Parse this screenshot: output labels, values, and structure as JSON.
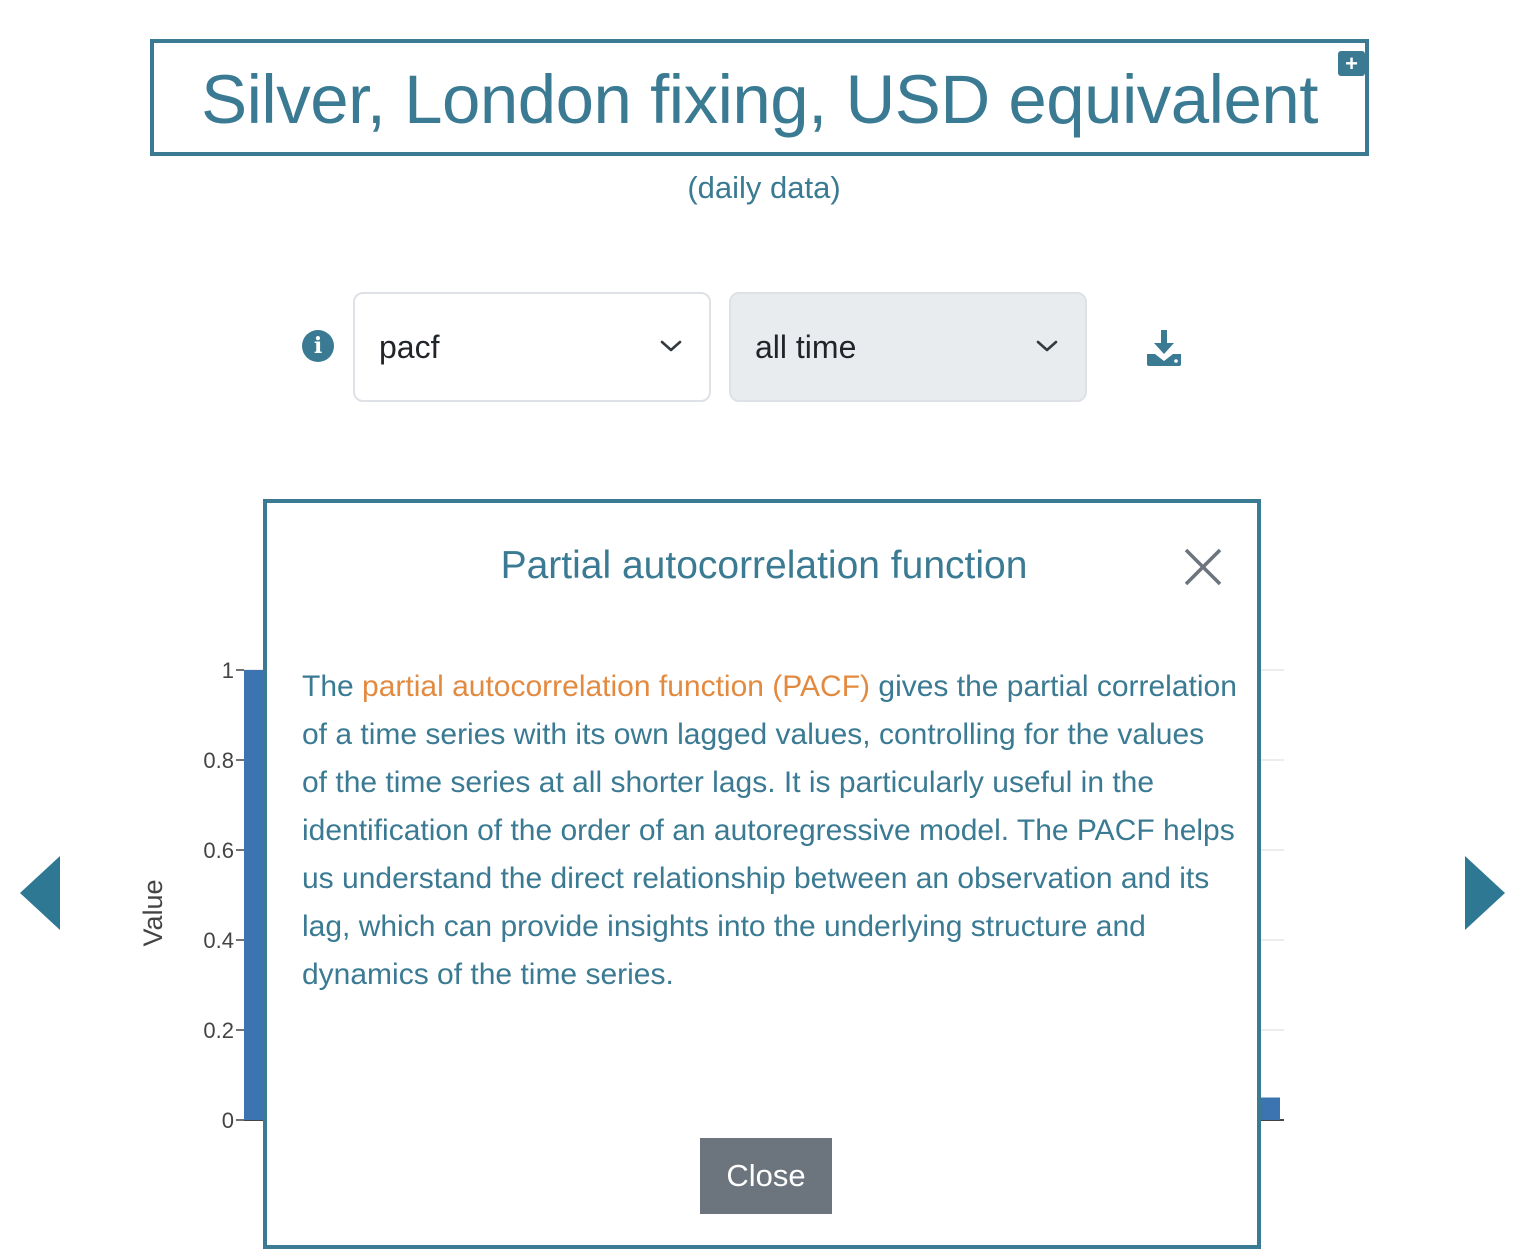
{
  "header": {
    "title": "Silver, London fixing, USD equivalent",
    "subtitle": "(daily data)",
    "expand_label": "+"
  },
  "controls": {
    "function_select": {
      "value": "pacf"
    },
    "range_select": {
      "value": "all time"
    }
  },
  "icons": {
    "info": "info-icon",
    "download": "download-icon",
    "expand": "plus-icon",
    "prev": "arrow-left-icon",
    "next": "arrow-right-icon",
    "close": "close-icon"
  },
  "colors": {
    "accent": "#3a7a93",
    "highlight": "#e38a41",
    "bar": "#3b74b1",
    "button_gray": "#6c757d"
  },
  "chart_data": {
    "type": "bar",
    "ylabel": "Value",
    "ylim": [
      0,
      1
    ],
    "yticks": [
      "0",
      "0.2",
      "0.4",
      "0.6",
      "0.8",
      "1"
    ],
    "lags": [
      0,
      1
    ],
    "values": [
      1,
      0.05
    ],
    "grid": true
  },
  "modal": {
    "title": "Partial autocorrelation function",
    "body_before": "The ",
    "body_highlight": "partial autocorrelation function (PACF)",
    "body_after": " gives the partial correlation of a time series with its own lagged values, controlling for the values of the time series at all shorter lags. It is particularly useful in the identification of the order of an autoregressive model. The PACF helps us understand the direct relationship between an observation and its lag, which can provide insights into the underlying structure and dynamics of the time series.",
    "close_label": "Close"
  }
}
